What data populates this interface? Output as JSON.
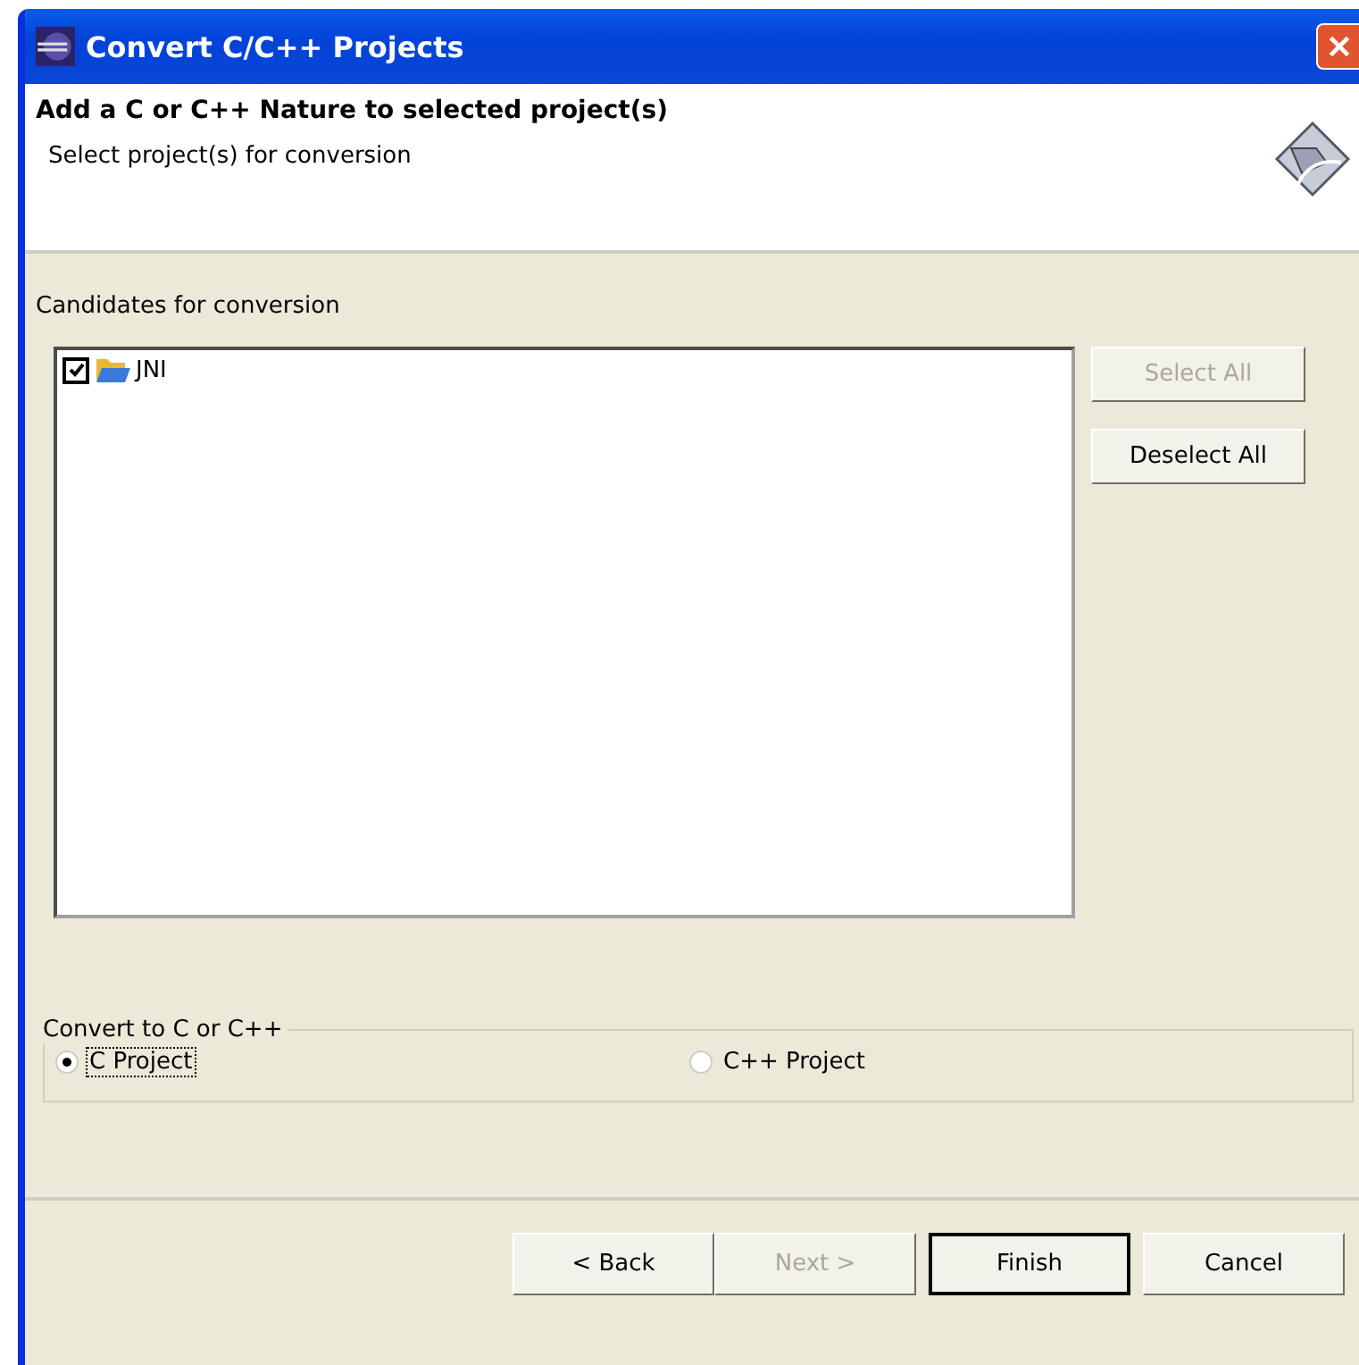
{
  "window": {
    "title": "Convert C/C++ Projects"
  },
  "header": {
    "title": "Add a C or C++ Nature to selected project(s)",
    "subtitle": "Select project(s) for conversion"
  },
  "candidates": {
    "label": "Candidates for conversion",
    "items": [
      {
        "name": "JNI",
        "checked": true
      }
    ]
  },
  "side_buttons": [
    {
      "label": "Select All",
      "disabled": true
    },
    {
      "label": "Deselect All",
      "disabled": false
    }
  ],
  "convert_group": {
    "label": "Convert to C or C++",
    "options": [
      {
        "label": "C Project",
        "selected": true,
        "focused": true
      },
      {
        "label": "C++ Project",
        "selected": false,
        "focused": false
      }
    ]
  },
  "buttons": [
    {
      "label": "< Back",
      "disabled": false,
      "default": false
    },
    {
      "label": "Next >",
      "disabled": true,
      "default": false
    },
    {
      "label": "Finish",
      "disabled": false,
      "default": true
    },
    {
      "label": "Cancel",
      "disabled": false,
      "default": false
    }
  ]
}
